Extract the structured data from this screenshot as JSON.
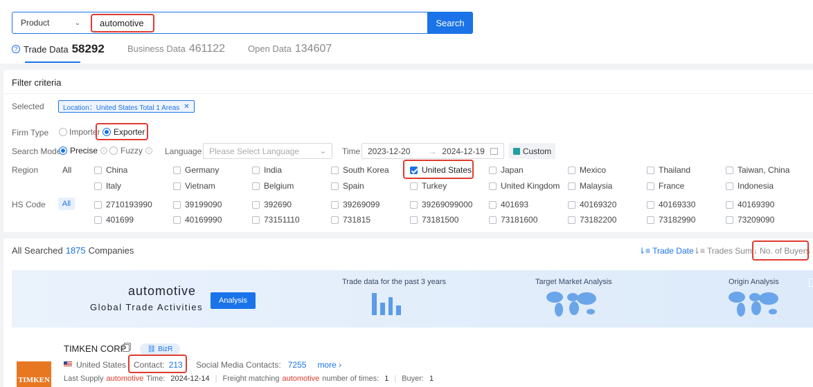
{
  "search": {
    "category": "Product",
    "query": "automotive",
    "button": "Search"
  },
  "tabs": [
    {
      "label": "Trade Data",
      "count": "58292"
    },
    {
      "label": "Business Data",
      "count": "461122"
    },
    {
      "label": "Open Data",
      "count": "134607"
    }
  ],
  "filter": {
    "title": "Filter criteria",
    "selected_label": "Selected",
    "selected_tag": "Location：United States Total 1 Areas",
    "firm_type_label": "Firm Type",
    "firm_types": [
      "Importer",
      "Exporter"
    ],
    "search_mode_label": "Search Mode",
    "search_modes": [
      "Precise",
      "Fuzzy"
    ],
    "language_label": "Language",
    "language_placeholder": "Please Select Language",
    "time_label": "Time",
    "time_start": "2023-12-20",
    "time_arrow": "→",
    "time_end": "2024-12-19",
    "custom": "Custom",
    "region_label": "Region",
    "region_all": "All",
    "regions": [
      "China",
      "Germany",
      "India",
      "South Korea",
      "United States",
      "Japan",
      "Mexico",
      "Thailand",
      "Taiwan, China",
      "Italy",
      "Vietnam",
      "Belgium",
      "Spain",
      "Turkey",
      "United Kingdom",
      "Malaysia",
      "France",
      "Indonesia"
    ],
    "hs_label": "HS Code",
    "hs_all": "All",
    "hs_codes": [
      "2710193990",
      "39199090",
      "392690",
      "39269099",
      "39269099000",
      "401693",
      "40169320",
      "40169330",
      "40169390",
      "401699",
      "40169990",
      "73151110",
      "731815",
      "73181500",
      "73181600",
      "73182200",
      "73182990",
      "73209090"
    ]
  },
  "results": {
    "prefix": "All Searched",
    "count": "1875",
    "suffix": "Companies",
    "sort": [
      "Trade Date",
      "Trades Sum",
      "No. of Buyers"
    ]
  },
  "banner": {
    "keyword": "automotive",
    "subtitle": "Global Trade Activities",
    "button": "Analysis",
    "sections": [
      "Trade data for the past 3 years",
      "Target Market Analysis",
      "Origin Analysis"
    ]
  },
  "company": {
    "name": "TIMKEN CORP",
    "badge": "BizR",
    "logo_text": "TIMKEN",
    "country": "United States",
    "contact_label": "Contact:",
    "contact_value": "213",
    "social_label": "Social Media Contacts:",
    "social_value": "7255",
    "more": "more",
    "last_supply_pre": "Last Supply",
    "last_supply_kw": "automotive",
    "last_supply_post": "Time:",
    "last_supply_date": "2024-12-14",
    "freight_pre": "Freight matching",
    "freight_kw": "automotive",
    "freight_post": "number of times:",
    "freight_value": "1",
    "buyer_label": "Buyer:",
    "buyer_value": "1"
  },
  "colors": {
    "accent": "#1a73e8",
    "highlight": "#e03a2f",
    "logo": "#e87722"
  }
}
